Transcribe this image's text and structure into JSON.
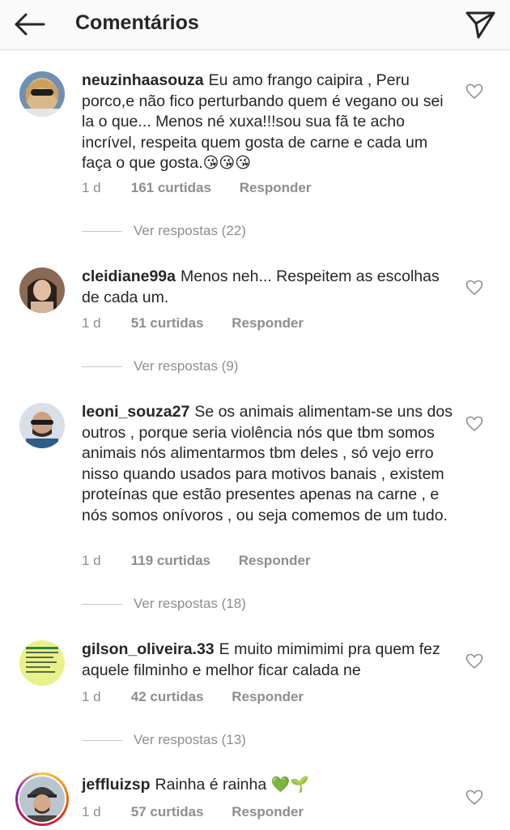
{
  "header": {
    "title": "Comentários",
    "back_icon": "arrow-left-icon",
    "send_icon": "paper-plane-icon"
  },
  "comments": [
    {
      "username": "neuzinhaasouza",
      "text": "Eu amo frango caipira , Peru porco,e não fico perturbando quem é vegano ou sei la o que... Menos né xuxa!!!sou sua fã te acho incrível, respeita quem gosta de carne e cada um faça o que gosta.",
      "emoji": "😘😘😘",
      "time": "1 d",
      "likes": "161 curtidas",
      "reply": "Responder",
      "view_replies": "Ver respostas (22)"
    },
    {
      "username": "cleidiane99a",
      "text": "Menos neh... Respeitem as escolhas de cada um.",
      "emoji": "",
      "time": "1 d",
      "likes": "51 curtidas",
      "reply": "Responder",
      "view_replies": "Ver respostas (9)"
    },
    {
      "username": "leoni_souza27",
      "text": "Se os animais alimentam-se uns dos outros , porque seria violência nós que tbm somos animais nós alimentarmos tbm deles , só vejo erro nisso quando usados para motivos banais , existem proteínas que estão presentes apenas na carne , e nós somos onívoros , ou seja comemos de um tudo.",
      "emoji": "",
      "time": "1 d",
      "likes": "119 curtidas",
      "reply": "Responder",
      "view_replies": "Ver respostas (18)"
    },
    {
      "username": "gilson_oliveira.33",
      "text": "E muito mimimimi pra quem fez aquele  filminho e melhor ficar calada ne",
      "emoji": "",
      "time": "1 d",
      "likes": "42 curtidas",
      "reply": "Responder",
      "view_replies": "Ver respostas (13)"
    },
    {
      "username": "jeffluizsp",
      "text": "Rainha é rainha",
      "emoji": "💚🌱",
      "time": "1 d",
      "likes": "57 curtidas",
      "reply": "Responder",
      "view_replies": ""
    }
  ],
  "icons": {
    "like": "heart-outline-icon"
  },
  "colors": {
    "text": "#262626",
    "secondary": "#8e8e8e",
    "divider": "#dbdbdb"
  }
}
